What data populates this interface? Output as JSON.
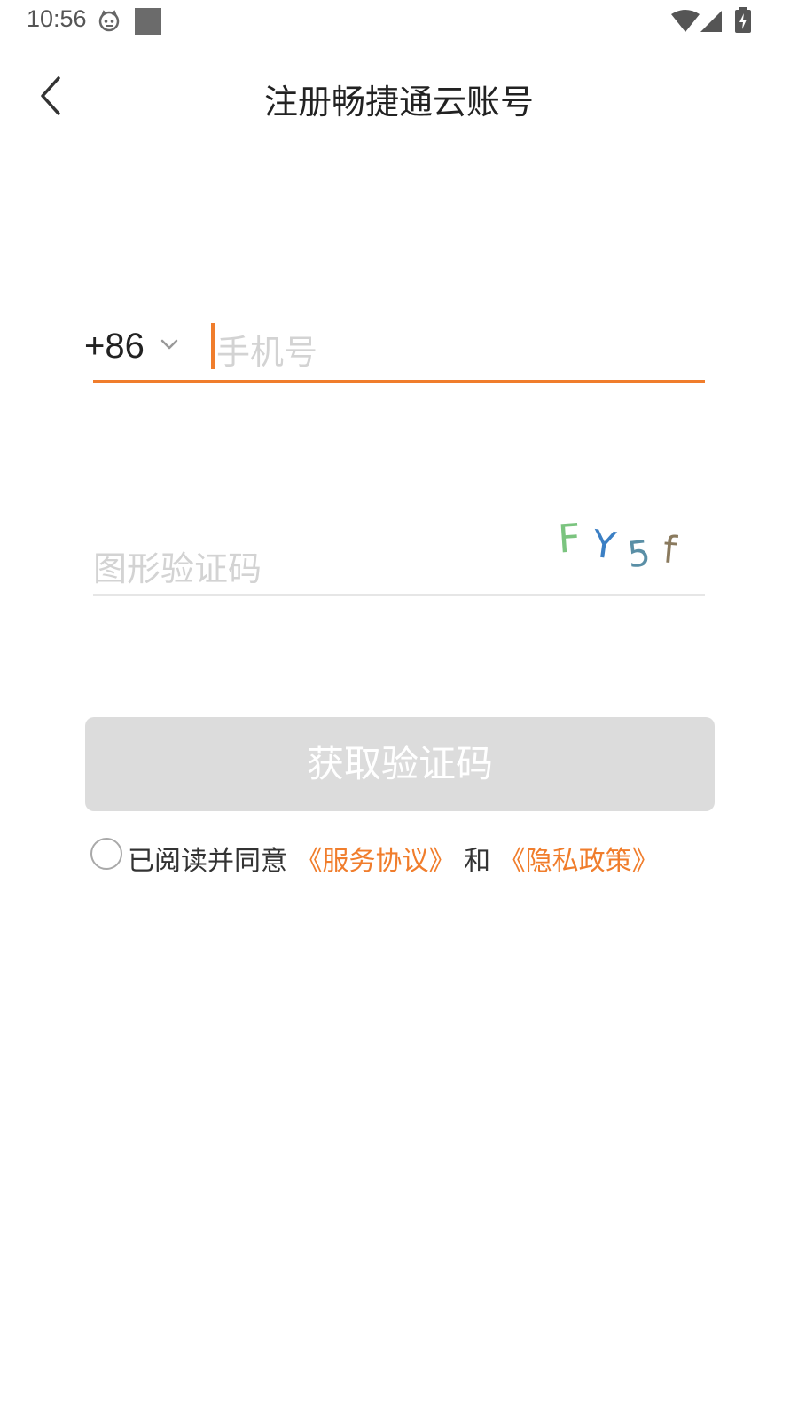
{
  "status_bar": {
    "time": "10:56",
    "icons": [
      "cat-face-icon",
      "square-notification-icon",
      "wifi-icon",
      "cell-signal-icon",
      "battery-charging-icon"
    ]
  },
  "header": {
    "back_icon": "chevron-left-icon",
    "title": "注册畅捷通云账号"
  },
  "phone": {
    "country_code": "+86",
    "placeholder": "手机号",
    "value": ""
  },
  "captcha": {
    "placeholder": "图形验证码",
    "value": "",
    "image_chars": [
      "F",
      "Y",
      "5",
      "f"
    ]
  },
  "get_code_button": {
    "label": "获取验证码",
    "enabled": false
  },
  "agreement": {
    "checked": false,
    "prefix": "已阅读并同意",
    "terms_link": "《服务协议》",
    "and": "和",
    "privacy_link": "《隐私政策》"
  },
  "colors": {
    "accent": "#f07d2c",
    "placeholder": "#d3d3d3",
    "button_disabled": "#dcdcdc",
    "captcha_chars": [
      "#7bc47f",
      "#3b7fc4",
      "#5a8fa6",
      "#8a7a5e"
    ]
  }
}
